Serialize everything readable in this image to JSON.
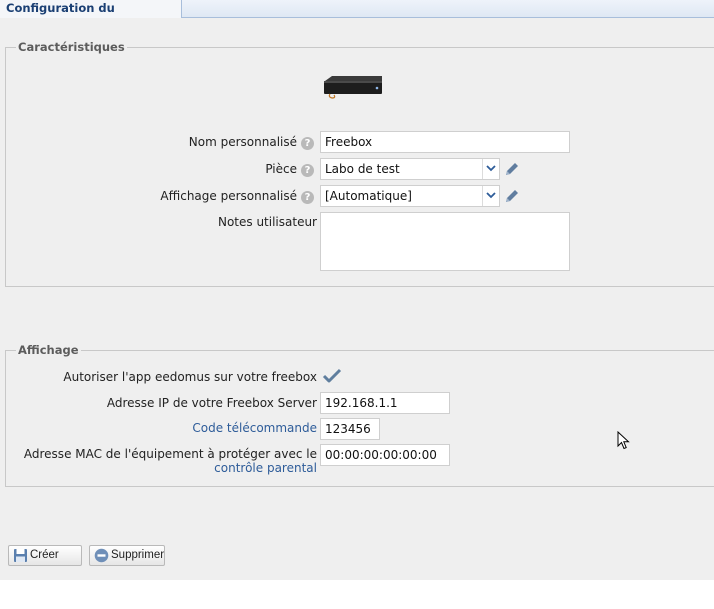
{
  "tab": {
    "title": "Configuration du périphérique"
  },
  "section_characteristics": {
    "legend": "Caractéristiques",
    "device_image": "freebox-server-device-icon",
    "name_label": "Nom personnalisé",
    "name_value": "Freebox",
    "room_label": "Pièce",
    "room_value": "Labo de test",
    "display_label": "Affichage personnalisé",
    "display_value": "[Automatique]",
    "notes_label": "Notes utilisateur",
    "notes_value": ""
  },
  "section_display": {
    "legend": "Affichage",
    "authorize_label": "Autoriser l'app eedomus sur votre freebox",
    "authorize_checked": true,
    "ip_label": "Adresse IP de votre Freebox Server",
    "ip_value": "192.168.1.1",
    "remote_code_label": "Code télécommande",
    "remote_code_value": "123456",
    "mac_label_line1": "Adresse MAC de l'équipement à protéger avec le",
    "mac_label_link": "contrôle parental",
    "mac_value": "00:00:00:00:00:00"
  },
  "actions": {
    "create_label": "Créer",
    "delete_label": "Supprimer"
  },
  "icons": {
    "help": "help-icon",
    "edit": "pencil-icon",
    "check": "checkmark-icon",
    "save": "floppy-disk-icon",
    "delete": "minus-circle-icon",
    "cursor": "mouse-pointer-icon"
  },
  "colors": {
    "link": "#2e5c99",
    "tab_text": "#1a3f73",
    "panel_bg": "#efefef"
  }
}
